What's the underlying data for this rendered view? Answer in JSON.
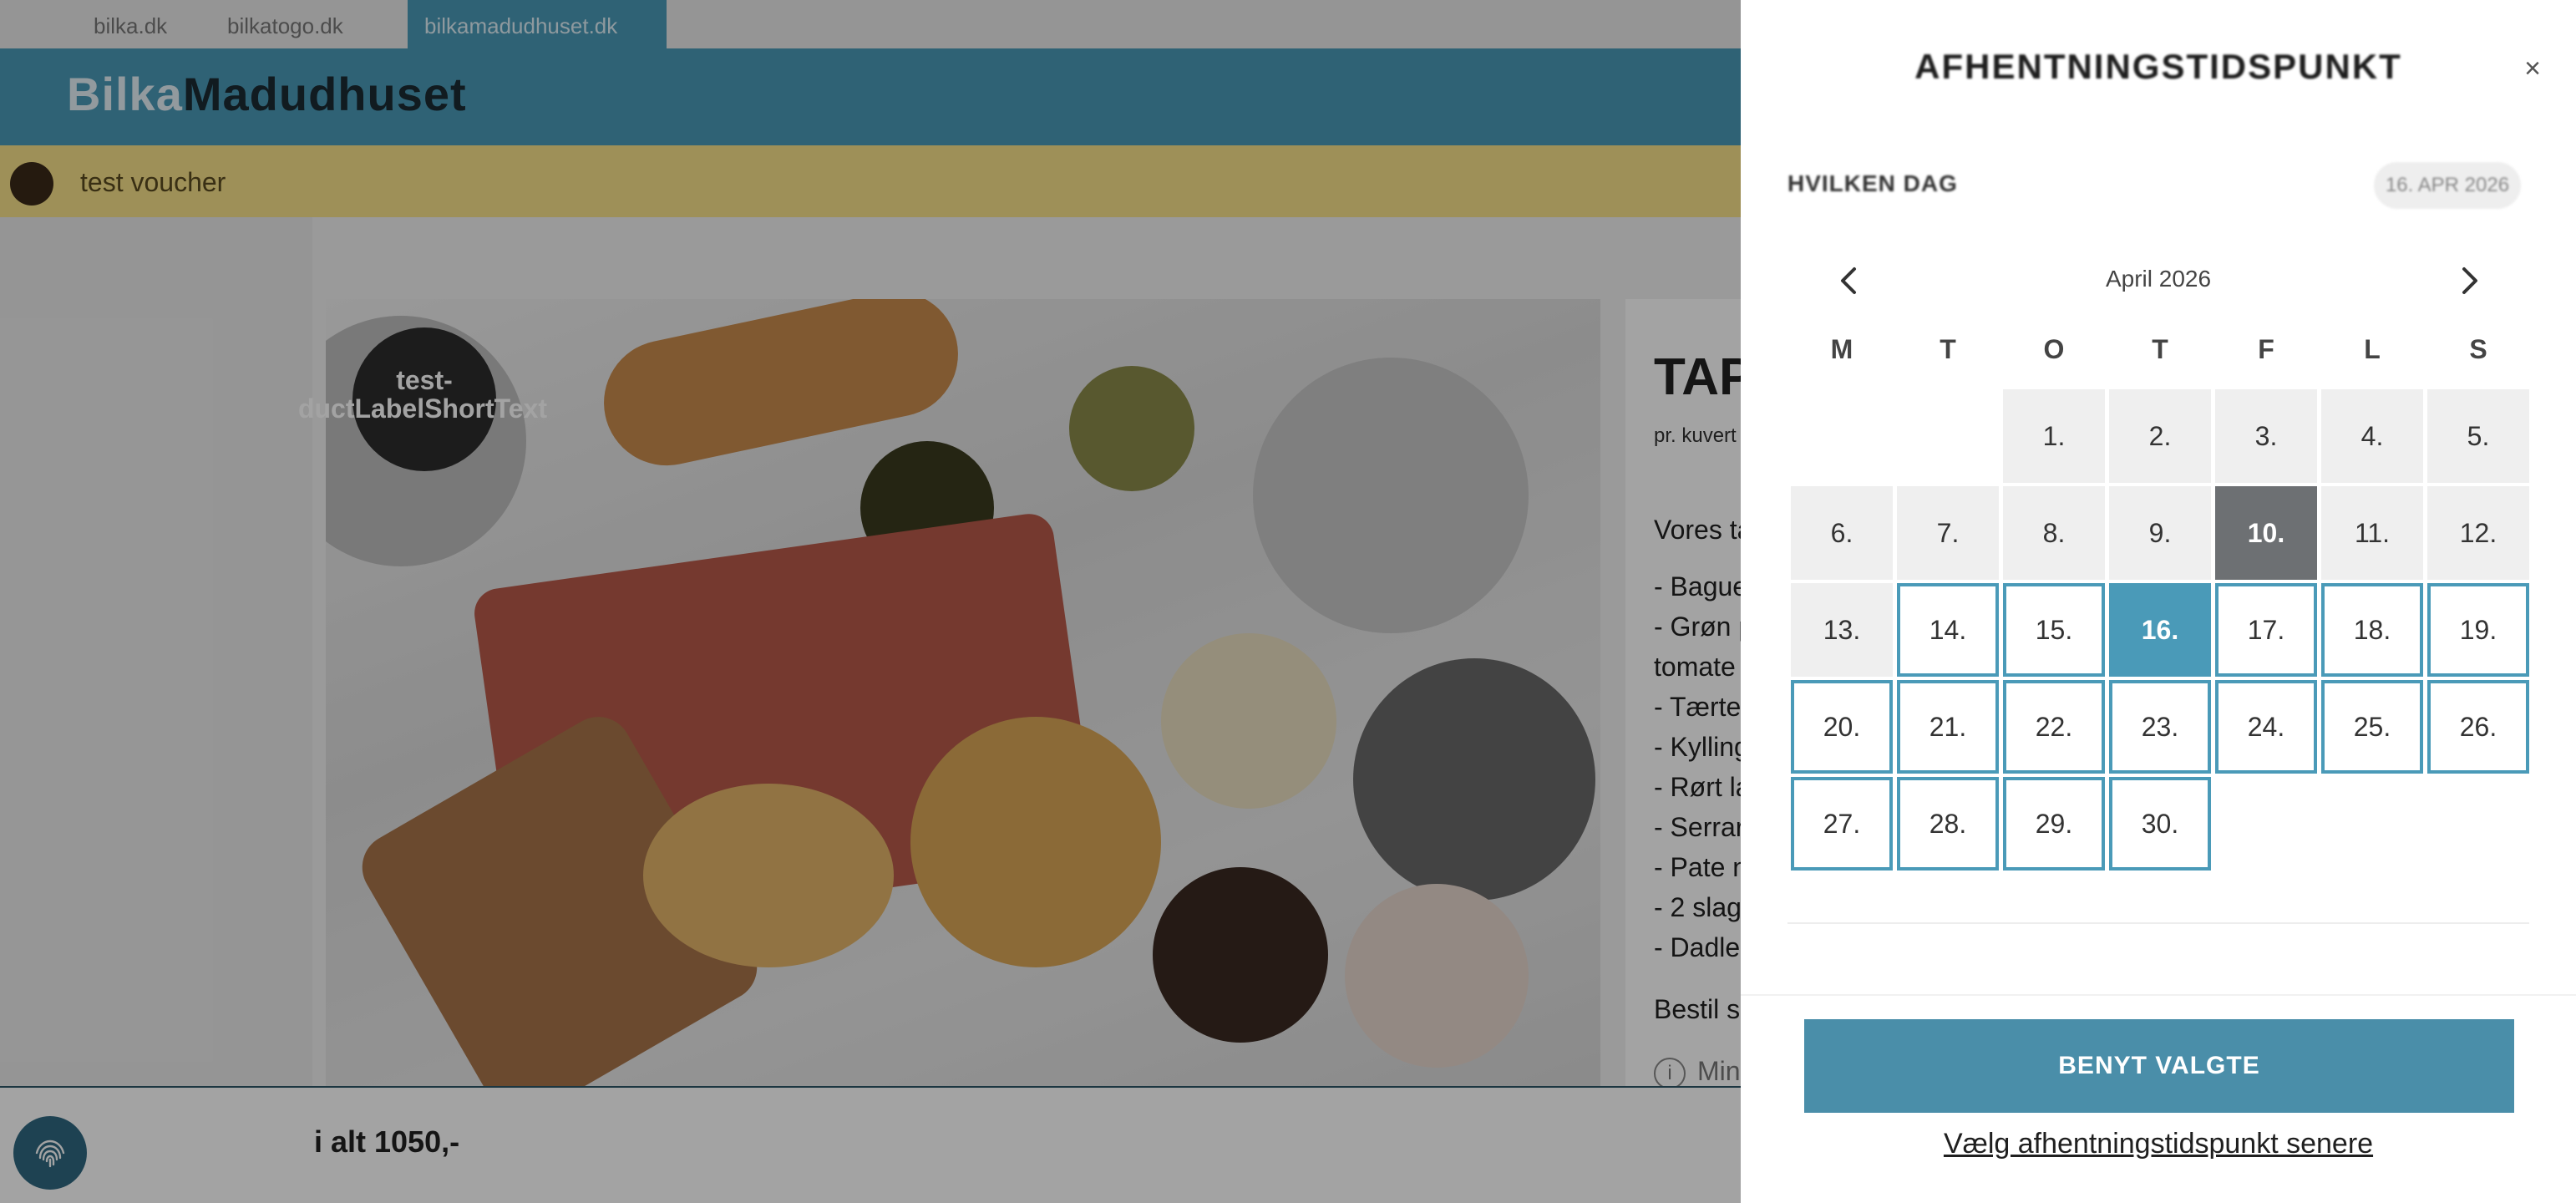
{
  "site_tabs": [
    "bilka.dk",
    "bilkatogo.dk",
    "bilkamadudhuset.dk"
  ],
  "brand": {
    "part1": "Bilka",
    "part2": "Madudhuset"
  },
  "voucher": {
    "text": "test voucher"
  },
  "product": {
    "badge_line1": "test-",
    "badge_line2": "ductLabelShortText",
    "title": "TAP",
    "subtitle": "pr. kuvert",
    "intro": "Vores ta",
    "items": [
      "- Bague",
      "- Grøn p",
      "tomate",
      "- Tærte",
      "- Kylling",
      "- Rørt la",
      "- Serrar",
      "- Pate n",
      "- 2 slag",
      "- Dadle"
    ],
    "order_text": "Bestil s",
    "min_text": "Min",
    "info_icon": "i"
  },
  "footer": {
    "total": "i alt 1050,-",
    "fingerprint_icon": "fingerprint-icon"
  },
  "drawer": {
    "title": "AFHENTNINGSTIDSPUNKT",
    "close_icon": "×",
    "day_question": "HVILKEN DAG",
    "selected_chip": "16. APR 2026",
    "month": "April 2026",
    "weekdays": [
      "M",
      "T",
      "O",
      "T",
      "F",
      "L",
      "S"
    ],
    "days": [
      {
        "label": "1.",
        "col": 2,
        "row": 0,
        "state": "past"
      },
      {
        "label": "2.",
        "col": 3,
        "row": 0,
        "state": "past"
      },
      {
        "label": "3.",
        "col": 4,
        "row": 0,
        "state": "past"
      },
      {
        "label": "4.",
        "col": 5,
        "row": 0,
        "state": "past"
      },
      {
        "label": "5.",
        "col": 6,
        "row": 0,
        "state": "past"
      },
      {
        "label": "6.",
        "col": 0,
        "row": 1,
        "state": "past"
      },
      {
        "label": "7.",
        "col": 1,
        "row": 1,
        "state": "past"
      },
      {
        "label": "8.",
        "col": 2,
        "row": 1,
        "state": "past"
      },
      {
        "label": "9.",
        "col": 3,
        "row": 1,
        "state": "past"
      },
      {
        "label": "10.",
        "col": 4,
        "row": 1,
        "state": "today"
      },
      {
        "label": "11.",
        "col": 5,
        "row": 1,
        "state": "past"
      },
      {
        "label": "12.",
        "col": 6,
        "row": 1,
        "state": "past"
      },
      {
        "label": "13.",
        "col": 0,
        "row": 2,
        "state": "past"
      },
      {
        "label": "14.",
        "col": 1,
        "row": 2,
        "state": "available"
      },
      {
        "label": "15.",
        "col": 2,
        "row": 2,
        "state": "available"
      },
      {
        "label": "16.",
        "col": 3,
        "row": 2,
        "state": "selected"
      },
      {
        "label": "17.",
        "col": 4,
        "row": 2,
        "state": "available"
      },
      {
        "label": "18.",
        "col": 5,
        "row": 2,
        "state": "available"
      },
      {
        "label": "19.",
        "col": 6,
        "row": 2,
        "state": "available"
      },
      {
        "label": "20.",
        "col": 0,
        "row": 3,
        "state": "available"
      },
      {
        "label": "21.",
        "col": 1,
        "row": 3,
        "state": "available"
      },
      {
        "label": "22.",
        "col": 2,
        "row": 3,
        "state": "available"
      },
      {
        "label": "23.",
        "col": 3,
        "row": 3,
        "state": "available"
      },
      {
        "label": "24.",
        "col": 4,
        "row": 3,
        "state": "available"
      },
      {
        "label": "25.",
        "col": 5,
        "row": 3,
        "state": "available"
      },
      {
        "label": "26.",
        "col": 6,
        "row": 3,
        "state": "available"
      },
      {
        "label": "27.",
        "col": 0,
        "row": 4,
        "state": "available"
      },
      {
        "label": "28.",
        "col": 1,
        "row": 4,
        "state": "available"
      },
      {
        "label": "29.",
        "col": 2,
        "row": 4,
        "state": "available"
      },
      {
        "label": "30.",
        "col": 3,
        "row": 4,
        "state": "available"
      }
    ],
    "apply_button": "BENYT VALGTE",
    "later_link": "Vælg afhentningstidspunkt senere"
  },
  "colors": {
    "accent": "#4a9ab8",
    "voucher_bg": "#f7e28a",
    "today_bg": "#6d7073",
    "past_bg": "#efefef"
  }
}
